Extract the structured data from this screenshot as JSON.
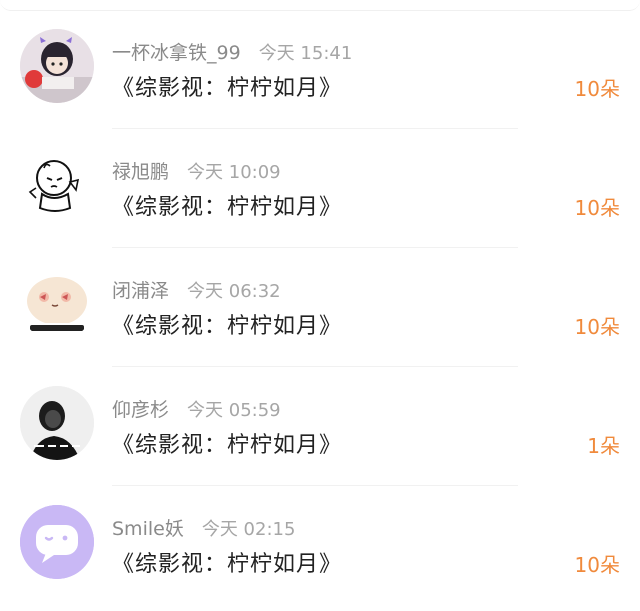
{
  "entries": [
    {
      "name": "一杯冰拿铁_99",
      "time": "今天 15:41",
      "title": "《综影视：柠柠如月》",
      "amount": "10朵",
      "avatar_icon": "girl-eating-avatar"
    },
    {
      "name": "禄旭鹏",
      "time": "今天 10:09",
      "title": "《综影视：柠柠如月》",
      "amount": "10朵",
      "avatar_icon": "cartoon-boy-avatar"
    },
    {
      "name": "闭浦泽",
      "time": "今天 06:32",
      "title": "《综影视：柠柠如月》",
      "amount": "10朵",
      "avatar_icon": "blob-emoji-avatar"
    },
    {
      "name": "仰彦杉",
      "time": "今天 05:59",
      "title": "《综影视：柠柠如月》",
      "amount": "1朵",
      "avatar_icon": "dark-photo-avatar"
    },
    {
      "name": "Smile妖",
      "time": "今天 02:15",
      "title": "《综影视：柠柠如月》",
      "amount": "10朵",
      "avatar_icon": "chat-bubble-avatar"
    }
  ],
  "colors": {
    "amount": "#f08a3c",
    "name": "#8a8a8a",
    "time": "#a6a6a6",
    "title": "#222222",
    "purple_avatar": "#c9b8f5"
  }
}
